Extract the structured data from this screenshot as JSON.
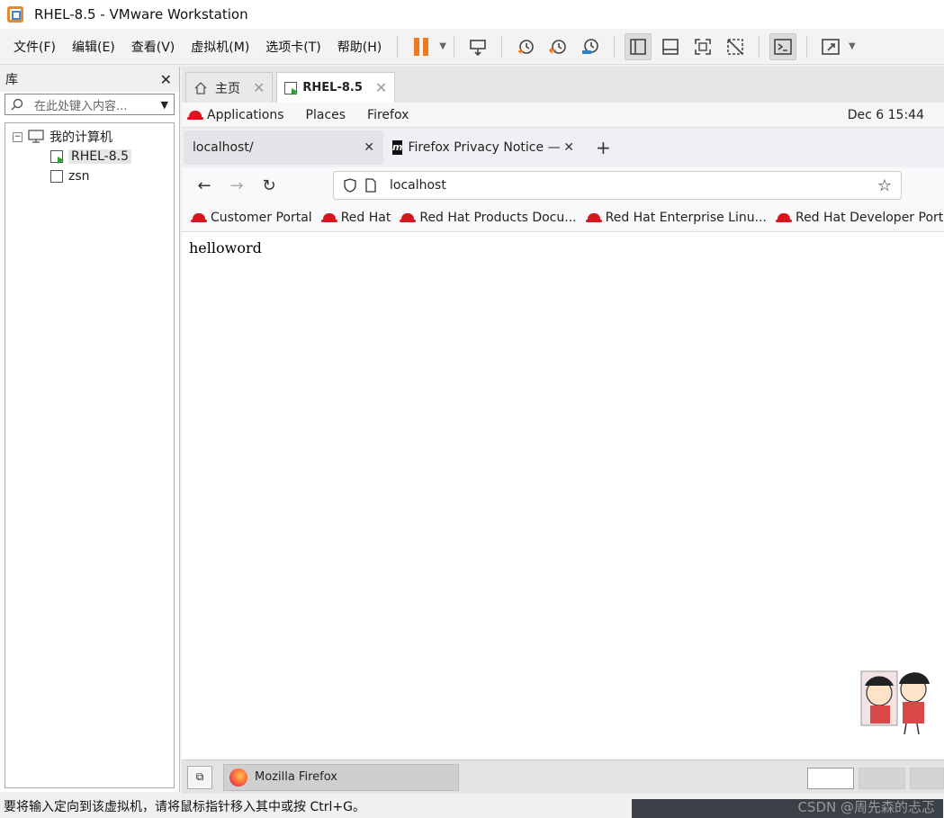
{
  "window": {
    "title": "RHEL-8.5 - VMware Workstation"
  },
  "menu": {
    "items": [
      "文件(F)",
      "编辑(E)",
      "查看(V)",
      "虚拟机(M)",
      "选项卡(T)",
      "帮助(H)"
    ]
  },
  "toolbar": {
    "icons": [
      "pause-icon",
      "send-ctrl-alt-del-icon",
      "snapshot-icon",
      "revert-snapshot-icon",
      "snapshot-manager-icon",
      "library-view-icon",
      "thumbnail-view-icon",
      "fullscreen-icon",
      "unity-icon",
      "console-icon",
      "stretch-icon"
    ]
  },
  "library": {
    "title": "库",
    "search_placeholder": "在此处键入内容...",
    "tree": {
      "root": "我的计算机",
      "vms": [
        "RHEL-8.5",
        "zsn"
      ],
      "selected": "RHEL-8.5"
    }
  },
  "tabs": [
    {
      "label": "主页",
      "active": false
    },
    {
      "label": "RHEL-8.5",
      "active": true
    }
  ],
  "gnome": {
    "menus": [
      "Applications",
      "Places",
      "Firefox"
    ],
    "clock": "Dec 6  15:44"
  },
  "firefox": {
    "tabs": [
      {
        "label": "localhost/",
        "active": true
      },
      {
        "label": "Firefox Privacy Notice — M",
        "active": false
      }
    ],
    "url": "localhost",
    "bookmarks": [
      "Customer Portal",
      "Red Hat",
      "Red Hat Products Docu...",
      "Red Hat Enterprise Linu...",
      "Red Hat Developer Portal"
    ],
    "page_text": "helloword"
  },
  "taskbar": {
    "app": "Mozilla Firefox"
  },
  "status": {
    "message": "要将输入定向到该虚拟机，请将鼠标指针移入其中或按 Ctrl+G。",
    "watermark": "CSDN @周先森的忐忑"
  },
  "colors": {
    "accent": "#f07a21",
    "redhat": "#d6161c"
  }
}
